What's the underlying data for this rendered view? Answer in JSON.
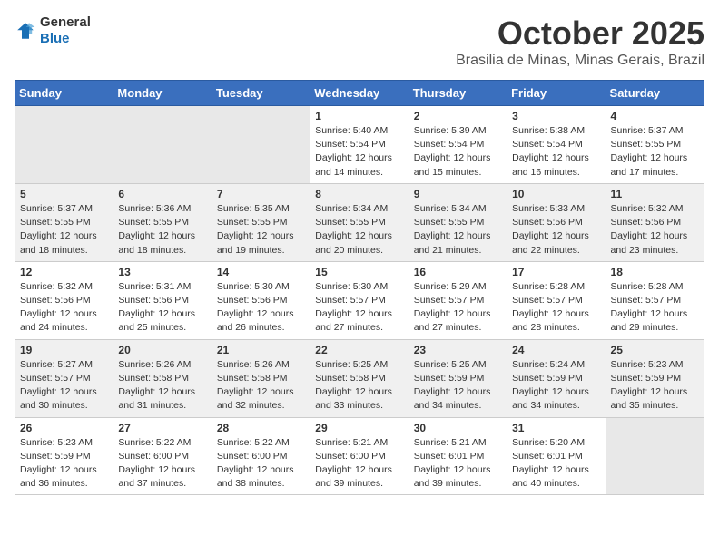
{
  "header": {
    "logo_general": "General",
    "logo_blue": "Blue",
    "month_title": "October 2025",
    "location": "Brasilia de Minas, Minas Gerais, Brazil"
  },
  "weekdays": [
    "Sunday",
    "Monday",
    "Tuesday",
    "Wednesday",
    "Thursday",
    "Friday",
    "Saturday"
  ],
  "rows": [
    [
      {
        "day": "",
        "empty": true
      },
      {
        "day": "",
        "empty": true
      },
      {
        "day": "",
        "empty": true
      },
      {
        "day": "1",
        "sunrise": "5:40 AM",
        "sunset": "5:54 PM",
        "daylight": "12 hours and 14 minutes."
      },
      {
        "day": "2",
        "sunrise": "5:39 AM",
        "sunset": "5:54 PM",
        "daylight": "12 hours and 15 minutes."
      },
      {
        "day": "3",
        "sunrise": "5:38 AM",
        "sunset": "5:54 PM",
        "daylight": "12 hours and 16 minutes."
      },
      {
        "day": "4",
        "sunrise": "5:37 AM",
        "sunset": "5:55 PM",
        "daylight": "12 hours and 17 minutes."
      }
    ],
    [
      {
        "day": "5",
        "sunrise": "5:37 AM",
        "sunset": "5:55 PM",
        "daylight": "12 hours and 18 minutes."
      },
      {
        "day": "6",
        "sunrise": "5:36 AM",
        "sunset": "5:55 PM",
        "daylight": "12 hours and 18 minutes."
      },
      {
        "day": "7",
        "sunrise": "5:35 AM",
        "sunset": "5:55 PM",
        "daylight": "12 hours and 19 minutes."
      },
      {
        "day": "8",
        "sunrise": "5:34 AM",
        "sunset": "5:55 PM",
        "daylight": "12 hours and 20 minutes."
      },
      {
        "day": "9",
        "sunrise": "5:34 AM",
        "sunset": "5:55 PM",
        "daylight": "12 hours and 21 minutes."
      },
      {
        "day": "10",
        "sunrise": "5:33 AM",
        "sunset": "5:56 PM",
        "daylight": "12 hours and 22 minutes."
      },
      {
        "day": "11",
        "sunrise": "5:32 AM",
        "sunset": "5:56 PM",
        "daylight": "12 hours and 23 minutes."
      }
    ],
    [
      {
        "day": "12",
        "sunrise": "5:32 AM",
        "sunset": "5:56 PM",
        "daylight": "12 hours and 24 minutes."
      },
      {
        "day": "13",
        "sunrise": "5:31 AM",
        "sunset": "5:56 PM",
        "daylight": "12 hours and 25 minutes."
      },
      {
        "day": "14",
        "sunrise": "5:30 AM",
        "sunset": "5:56 PM",
        "daylight": "12 hours and 26 minutes."
      },
      {
        "day": "15",
        "sunrise": "5:30 AM",
        "sunset": "5:57 PM",
        "daylight": "12 hours and 27 minutes."
      },
      {
        "day": "16",
        "sunrise": "5:29 AM",
        "sunset": "5:57 PM",
        "daylight": "12 hours and 27 minutes."
      },
      {
        "day": "17",
        "sunrise": "5:28 AM",
        "sunset": "5:57 PM",
        "daylight": "12 hours and 28 minutes."
      },
      {
        "day": "18",
        "sunrise": "5:28 AM",
        "sunset": "5:57 PM",
        "daylight": "12 hours and 29 minutes."
      }
    ],
    [
      {
        "day": "19",
        "sunrise": "5:27 AM",
        "sunset": "5:57 PM",
        "daylight": "12 hours and 30 minutes."
      },
      {
        "day": "20",
        "sunrise": "5:26 AM",
        "sunset": "5:58 PM",
        "daylight": "12 hours and 31 minutes."
      },
      {
        "day": "21",
        "sunrise": "5:26 AM",
        "sunset": "5:58 PM",
        "daylight": "12 hours and 32 minutes."
      },
      {
        "day": "22",
        "sunrise": "5:25 AM",
        "sunset": "5:58 PM",
        "daylight": "12 hours and 33 minutes."
      },
      {
        "day": "23",
        "sunrise": "5:25 AM",
        "sunset": "5:59 PM",
        "daylight": "12 hours and 34 minutes."
      },
      {
        "day": "24",
        "sunrise": "5:24 AM",
        "sunset": "5:59 PM",
        "daylight": "12 hours and 34 minutes."
      },
      {
        "day": "25",
        "sunrise": "5:23 AM",
        "sunset": "5:59 PM",
        "daylight": "12 hours and 35 minutes."
      }
    ],
    [
      {
        "day": "26",
        "sunrise": "5:23 AM",
        "sunset": "5:59 PM",
        "daylight": "12 hours and 36 minutes."
      },
      {
        "day": "27",
        "sunrise": "5:22 AM",
        "sunset": "6:00 PM",
        "daylight": "12 hours and 37 minutes."
      },
      {
        "day": "28",
        "sunrise": "5:22 AM",
        "sunset": "6:00 PM",
        "daylight": "12 hours and 38 minutes."
      },
      {
        "day": "29",
        "sunrise": "5:21 AM",
        "sunset": "6:00 PM",
        "daylight": "12 hours and 39 minutes."
      },
      {
        "day": "30",
        "sunrise": "5:21 AM",
        "sunset": "6:01 PM",
        "daylight": "12 hours and 39 minutes."
      },
      {
        "day": "31",
        "sunrise": "5:20 AM",
        "sunset": "6:01 PM",
        "daylight": "12 hours and 40 minutes."
      },
      {
        "day": "",
        "empty": true
      }
    ]
  ],
  "labels": {
    "sunrise_prefix": "Sunrise: ",
    "sunset_prefix": "Sunset: ",
    "daylight_label": "Daylight: "
  }
}
